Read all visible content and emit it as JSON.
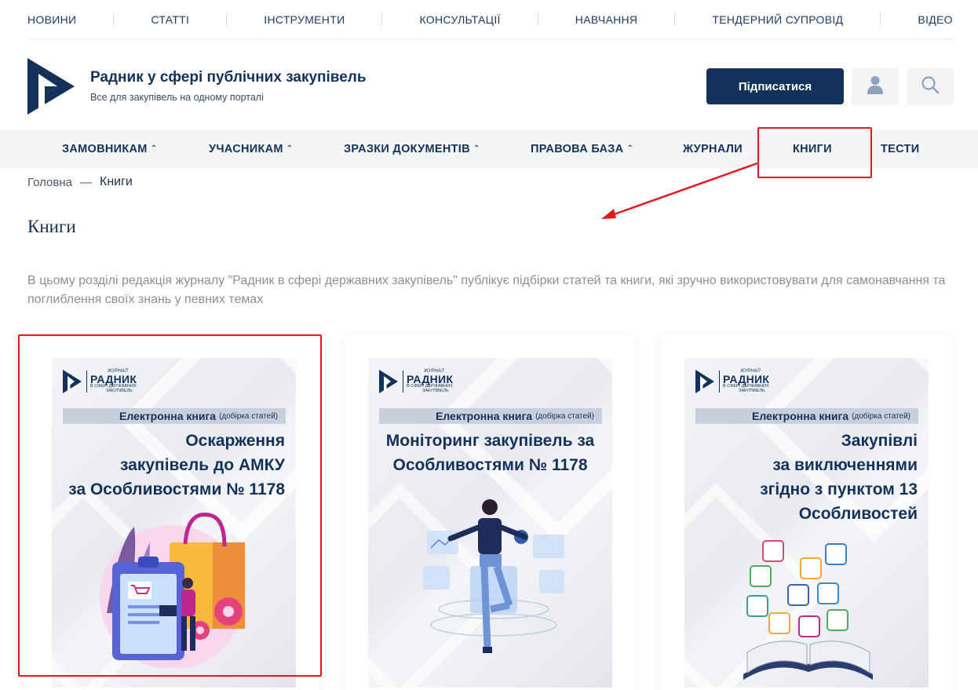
{
  "topnav": {
    "items": [
      "НОВИНИ",
      "СТАТТІ",
      "ІНСТРУМЕНТИ",
      "КОНСУЛЬТАЦІЇ",
      "НАВЧАННЯ",
      "ТЕНДЕРНИЙ СУПРОВІД",
      "ВІДЕО"
    ]
  },
  "header": {
    "title": "Радник у сфері публічних закупівель",
    "subtitle": "Все для закупівель на одному порталі",
    "subscribe_label": "Підписатися",
    "user_icon": "user-icon",
    "search_icon": "search-icon"
  },
  "mainmenu": {
    "items": [
      {
        "label": "ЗАМОВНИКАМ",
        "chevron": "⌃"
      },
      {
        "label": "УЧАСНИКАМ",
        "chevron": "⌃"
      },
      {
        "label": "ЗРАЗКИ ДОКУМЕНТІВ",
        "chevron": "⌃"
      },
      {
        "label": "ПРАВОВА БАЗА",
        "chevron": "⌃"
      },
      {
        "label": "ЖУРНАЛИ"
      },
      {
        "label": "КНИГИ"
      },
      {
        "label": "ТЕСТИ"
      }
    ]
  },
  "breadcrumb": {
    "home": "Головна",
    "separator": "—",
    "current": "Книги"
  },
  "page": {
    "title": "Книги",
    "intro": "В цьому розділі редакція журналу \"Радник в сфері державних закупівель\" публікує підбірки статей та книги, які зручно використовувати для самонавчання та поглиблення своїх знань у певних темах"
  },
  "cover_common": {
    "logo_top": "ЖУРНАЛ",
    "logo_main": "РАДНИК",
    "logo_line1": "В СФЕРІ ДЕРЖАВНИХ",
    "logo_line2": "ЗАКУПІВЕЛЬ",
    "band_main": "Електронна книга",
    "band_small": "(добірка статей)"
  },
  "books": [
    {
      "title_lines": [
        "Оскарження",
        "закупівель до АМКУ",
        "за Особливостями № 1178"
      ]
    },
    {
      "title_lines": [
        "Моніторинг закупівель за",
        "Особливостями № 1178"
      ]
    },
    {
      "title_lines": [
        "Закупівлі",
        "за виключеннями",
        "згідно з пунктом 13",
        "Особливостей"
      ]
    }
  ],
  "colors": {
    "brand_navy": "#13325a",
    "highlight_red": "#e5171d",
    "menu_bg": "#f4f6f6"
  }
}
